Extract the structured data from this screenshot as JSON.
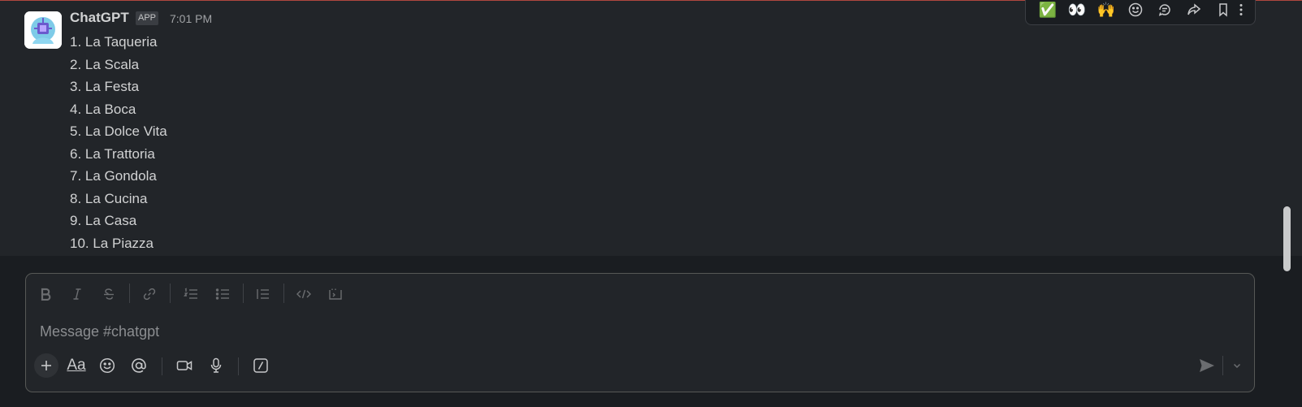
{
  "message": {
    "sender": "ChatGPT",
    "badge": "APP",
    "time": "7:01 PM",
    "items": [
      "1. La Taqueria",
      "2. La Scala",
      "3. La Festa",
      "4. La Boca",
      "5. La Dolce Vita",
      "6. La Trattoria",
      "7. La Gondola",
      "8. La Cucina",
      "9. La Casa",
      "10. La Piazza"
    ]
  },
  "reactions": {
    "check": "✅",
    "eyes": "👀",
    "raised_hands": "🙌"
  },
  "composer": {
    "placeholder": "Message #chatgpt",
    "format_label": "Aa"
  }
}
